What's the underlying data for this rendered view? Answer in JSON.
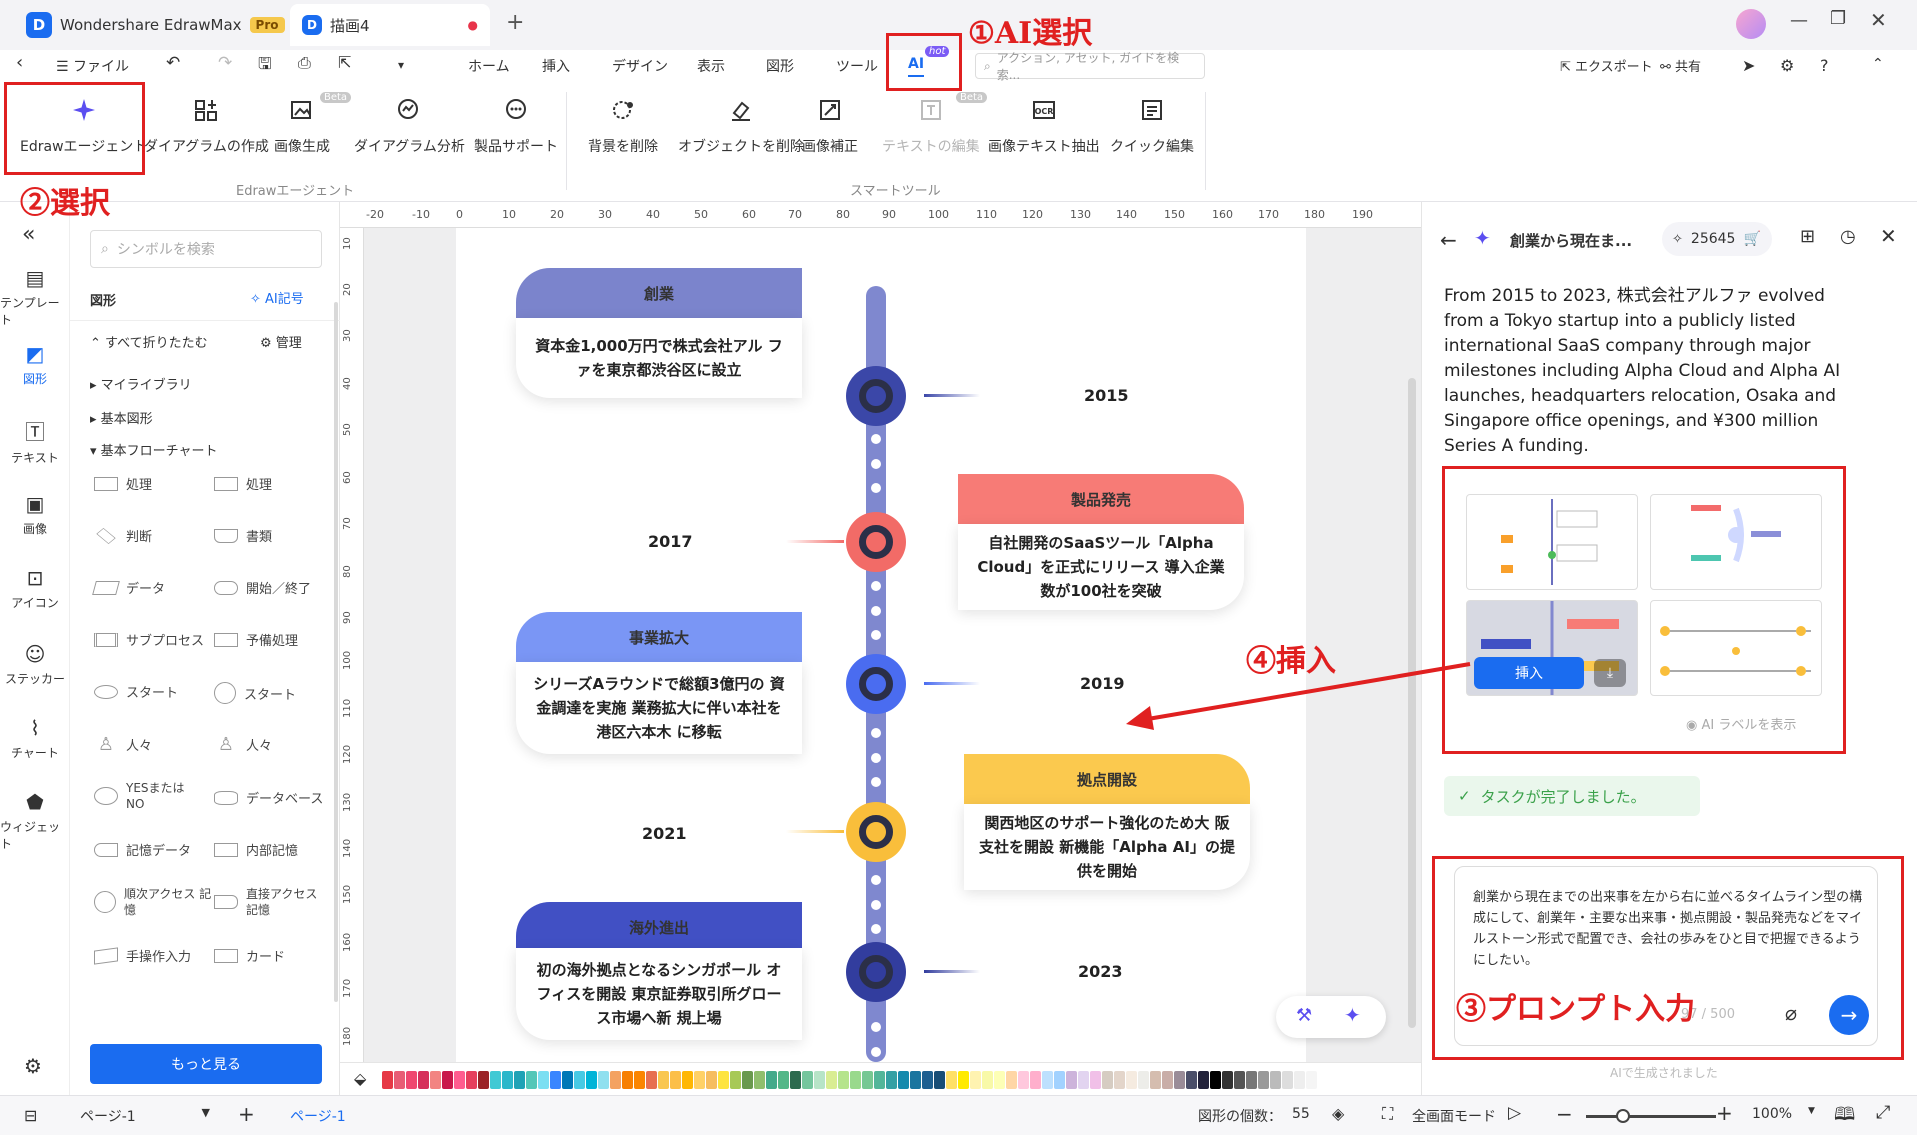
{
  "titlebar": {
    "app_name": "Wondershare EdrawMax",
    "pro_badge": "Pro",
    "doc_tab": "描画4"
  },
  "menubar": {
    "file": "ファイル",
    "tabs": [
      "ホーム",
      "挿入",
      "デザイン",
      "表示",
      "図形",
      "ツール",
      "AI"
    ],
    "hot_badge": "hot",
    "search_placeholder": "アクション, アセット, ガイドを検索...",
    "export": "エクスポート",
    "share": "共有"
  },
  "ribbon": {
    "agent": "Edrawエージェント",
    "diagram_create": "ダイアグラムの作成",
    "image_gen": "画像生成",
    "diagram_analysis": "ダイアグラム分析",
    "product_support": "製品サポート",
    "bg_remove": "背景を削除",
    "obj_remove": "オブジェクトを削除",
    "image_fix": "画像補正",
    "text_edit": "テキストの編集",
    "ocr": "画像テキスト抽出",
    "quick_edit": "クイック編集",
    "beta": "Beta",
    "group1": "Edrawエージェント",
    "group2": "スマートツール"
  },
  "rail": [
    "テンプレート",
    "図形",
    "テキスト",
    "画像",
    "アイコン",
    "ステッカー",
    "チャート",
    "ウィジェット"
  ],
  "symbols": {
    "search_placeholder": "シンボルを検索",
    "header": "図形",
    "ai_symbol": "AI記号",
    "collapse_all": "すべて折りたたむ",
    "manage": "管理",
    "my_library": "マイライブラリ",
    "basic_shapes": "基本図形",
    "basic_flowchart": "基本フローチャート",
    "items": [
      "処理",
      "処理",
      "判断",
      "書類",
      "データ",
      "開始／終了",
      "サブプロセス",
      "予備処理",
      "スタート",
      "スタート",
      "人々",
      "人々",
      "YESまたは NO",
      "データベース",
      "記憶データ",
      "内部記憶",
      "順次アクセス 記憶",
      "直接アクセス 記憶",
      "手操作入力",
      "カード"
    ],
    "more": "もっと見る"
  },
  "ruler": {
    "h_ticks": [
      "-20",
      "-10",
      "0",
      "10",
      "20",
      "30",
      "40",
      "50",
      "60",
      "70",
      "80",
      "90",
      "100",
      "110",
      "120",
      "130",
      "140",
      "150",
      "160",
      "170",
      "180",
      "190"
    ],
    "v_ticks": [
      "10",
      "20",
      "30",
      "40",
      "50",
      "60",
      "70",
      "80",
      "90",
      "100",
      "110",
      "120",
      "130",
      "140",
      "150",
      "160",
      "170",
      "180"
    ]
  },
  "timeline": [
    {
      "head": "創業",
      "body": "資本金1,000万円で株式会社アル ファを東京都渋谷区に設立",
      "year": "2015",
      "color": "#7b84cc",
      "node": "#3b47a8"
    },
    {
      "head": "製品発売",
      "body": "自社開発のSaaSツール「Alpha Cloud」を正式にリリース 導入企業数が100社を突破",
      "year": "2017",
      "color": "#f77b76",
      "node": "#f26b67"
    },
    {
      "head": "事業拡大",
      "body": "シリーズAラウンドで総額3億円の 資金調達を実施 業務拡大に伴い本社を港区六本木 に移転",
      "year": "2019",
      "color": "#7a96f5",
      "node": "#4a6cf0"
    },
    {
      "head": "拠点開設",
      "body": "関西地区のサポート強化のため大 阪支社を開設 新機能「Alpha AI」の提供を開始",
      "year": "2021",
      "color": "#fbc94e",
      "node": "#f9be3b"
    },
    {
      "head": "海外進出",
      "body": "初の海外拠点となるシンガポール オフィスを開設 東京証券取引所グロース市場へ新 規上場",
      "year": "2023",
      "color": "#4150c4",
      "node": "#323d9e"
    }
  ],
  "status": {
    "page_select": "ページ-1",
    "page_tab": "ページ-1",
    "shape_count_label": "図形の個数：",
    "shape_count": "55",
    "fullscreen": "全画面モード",
    "zoom": "100%"
  },
  "rpanel": {
    "title": "創業から現在ま...",
    "credits": "25645",
    "summary": "From 2015 to 2023, 株式会社アルファ evolved from a Tokyo startup into a publicly listed international SaaS company through major milestones including Alpha Cloud and Alpha AI launches, headquarters relocation, Osaka and Singapore office openings, and ¥300 million Series A funding.",
    "insert": "挿入",
    "ai_label": "AI ラベルを表示",
    "task_done": "タスクが完了しました。",
    "prompt": "創業から現在までの出来事を左から右に並べるタイムライン型の構成にして、創業年・主要な出来事・拠点開設・製品発売などをマイルストーン形式で配置でき、会社の歩みをひと目で把握できるようにしたい。",
    "char_count": "97 / 500",
    "footer": "AIで生成されました"
  },
  "annotations": {
    "a1": "①AI選択",
    "a2": "②選択",
    "a3": "③プロンプト入力",
    "a4": "④挿入"
  },
  "palette_colors": [
    "#e63946",
    "#e85d75",
    "#ef476f",
    "#d62f5a",
    "#f28482",
    "#c9184a",
    "#ff5d8f",
    "#e63e5c",
    "#9b2226",
    "#40c9d4",
    "#2ab7ca",
    "#1fa2b6",
    "#52c7b8",
    "#7bdff2",
    "#3a86ff",
    "#0077b6",
    "#48cae4",
    "#00b4d8",
    "#90e0ef",
    "#f4a261",
    "#f77f00",
    "#fb8500",
    "#e76f51",
    "#f9c74f",
    "#fcbf49",
    "#ffb703",
    "#ffd166",
    "#f6bd60",
    "#fee440",
    "#a7c957",
    "#6a994e",
    "#90be6d",
    "#43aa8b",
    "#52b788",
    "#2d6a4f",
    "#74c69d",
    "#b7e4c7",
    "#d9ed92",
    "#b5e48c",
    "#99d98c",
    "#76c893",
    "#52b69a",
    "#34a0a4",
    "#168aad",
    "#1a759f",
    "#1e6091",
    "#184e77",
    "#ffe066",
    "#ffea00",
    "#fff3b0",
    "#f8f9a8",
    "#fdffb6",
    "#ffd6a5",
    "#ffc8dd",
    "#ffafcc",
    "#bde0fe",
    "#a2d2ff",
    "#cdb4db",
    "#e2d4f0",
    "#f1c0e8",
    "#d6ccc2",
    "#e3d5ca",
    "#f5ebe0",
    "#edede9",
    "#d5bdaf",
    "#c9ada7",
    "#9a8c98",
    "#4a4e69",
    "#22223b",
    "#000000",
    "#333333",
    "#555555",
    "#777777",
    "#999999",
    "#bbbbbb",
    "#dddddd",
    "#eeeeee",
    "#f5f5f5",
    "#ffffff"
  ]
}
